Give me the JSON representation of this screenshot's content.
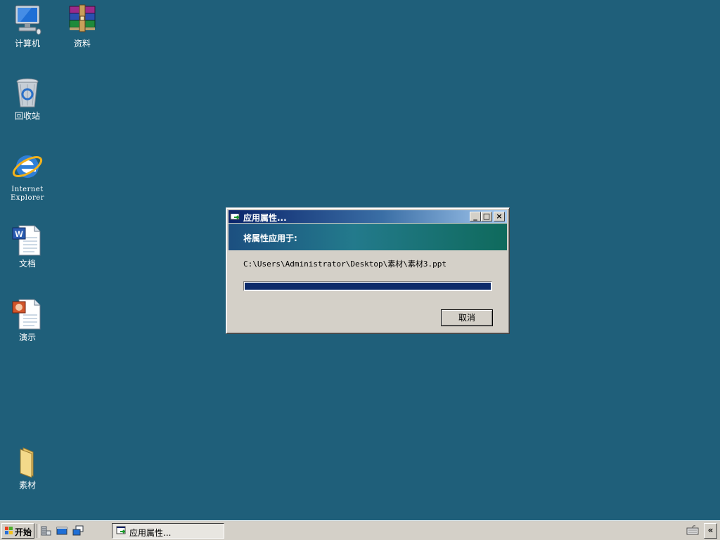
{
  "desktop": {
    "icons": [
      {
        "label": "计算机",
        "icon": "computer-icon"
      },
      {
        "label": "资料",
        "icon": "winrar-archive-icon"
      },
      {
        "label": "回收站",
        "icon": "recycle-bin-icon"
      },
      {
        "label": "Internet\nExplorer",
        "icon": "internet-explorer-icon"
      },
      {
        "label": "文档",
        "icon": "word-document-icon"
      },
      {
        "label": "演示",
        "icon": "powerpoint-document-icon"
      },
      {
        "label": "素材",
        "icon": "folder-icon"
      }
    ]
  },
  "dialog": {
    "title": "应用属性...",
    "banner_text": "将属性应用于:",
    "path": "C:\\Users\\Administrator\\Desktop\\素材\\素材3.ppt",
    "progress": 1.0,
    "cancel_label": "取消",
    "buttons": {
      "minimize": "_",
      "maximize": "□",
      "close": "×"
    }
  },
  "taskbar": {
    "start_label": "开始",
    "task_label": "应用属性...",
    "tray_expand_label": "«"
  },
  "colors": {
    "desktop": "#1f5f7a",
    "title_active": "#0a246a",
    "progress_fill": "#0c2a6a",
    "face": "#d4d0c8"
  }
}
